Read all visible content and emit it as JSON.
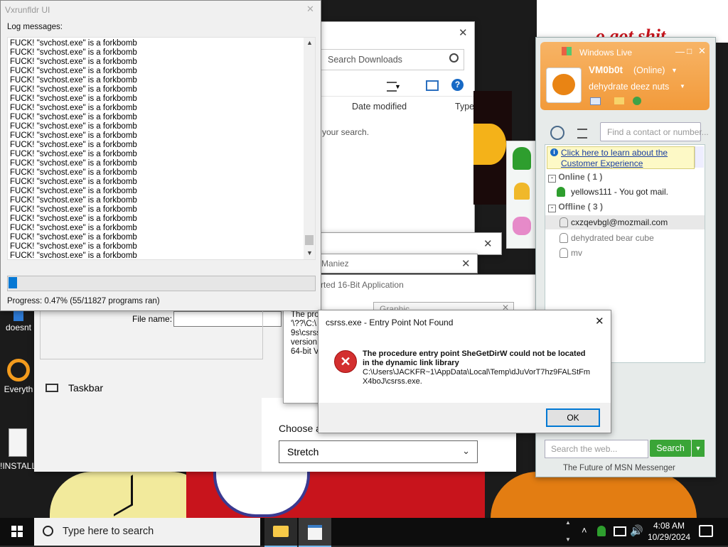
{
  "vx": {
    "title": "Vxrunfldr UI",
    "log_label": "Log messages:",
    "log_line": "FUCK! \"svchost.exe\" is a forkbomb",
    "log_count": 24,
    "progress_fraction": 0.0047,
    "progress_text": "Progress: 0.47% (55/11827 programs ran)"
  },
  "explorer": {
    "search_placeholder": "Search Downloads",
    "col_date": "Date modified",
    "col_type": "Type",
    "empty_text": "your search."
  },
  "settings": {
    "file_name_label": "File name:",
    "taskbar_label": "Taskbar",
    "choose_label": "Choose a",
    "stretch_value": "Stretch"
  },
  "stack": {
    "maniez": "Maniez",
    "sixteen_bit": "rted 16-Bit Application",
    "graphic": "Graphic",
    "partial": [
      "The pro",
      "'\\??\\C:\\",
      "9s\\csrss",
      "version",
      "64-bit V"
    ]
  },
  "error": {
    "title": "csrss.exe - Entry Point Not Found",
    "message_line1": "The procedure entry point SheGetDirW could not be located",
    "message_line2": "in the dynamic link library",
    "message_line3": "C:\\Users\\JACKFR~1\\AppData\\Local\\Temp\\dJuVorT7hz9FALStFm",
    "message_line4": "X4boJ\\csrss.exe.",
    "ok_label": "OK"
  },
  "msn": {
    "brand": "Windows Live",
    "username": "VM0b0t",
    "status": "(Online)",
    "personal_message": "dehydrate deez nuts",
    "find_placeholder": "Find a contact or number...",
    "info_link_line1": "Click here to learn about the",
    "info_link_line2": "Customer Experience",
    "online_header": "Online ( 1 )",
    "offline_header": "Offline ( 3 )",
    "online_contacts": [
      "yellows111 - You got mail."
    ],
    "offline_contacts": [
      "cxzqevbgl@mozmail.com",
      "dehydrated bear cube",
      "mv"
    ],
    "web_search_placeholder": "Search the web...",
    "search_button": "Search",
    "footer": "The Future of MSN Messenger"
  },
  "desktop": {
    "icon1": "doesnt",
    "icon2": "Everyth",
    "icon3": "!INSTALL",
    "graffiti": "o got shit"
  },
  "taskbar": {
    "search_text": "Type here to search",
    "time": "4:08 AM",
    "date": "10/29/2024"
  },
  "colors": {
    "msn_orange": "#f7a84a",
    "msn_green": "#3aa537",
    "error_red": "#d32f2f",
    "progress_blue": "#0678d4"
  }
}
